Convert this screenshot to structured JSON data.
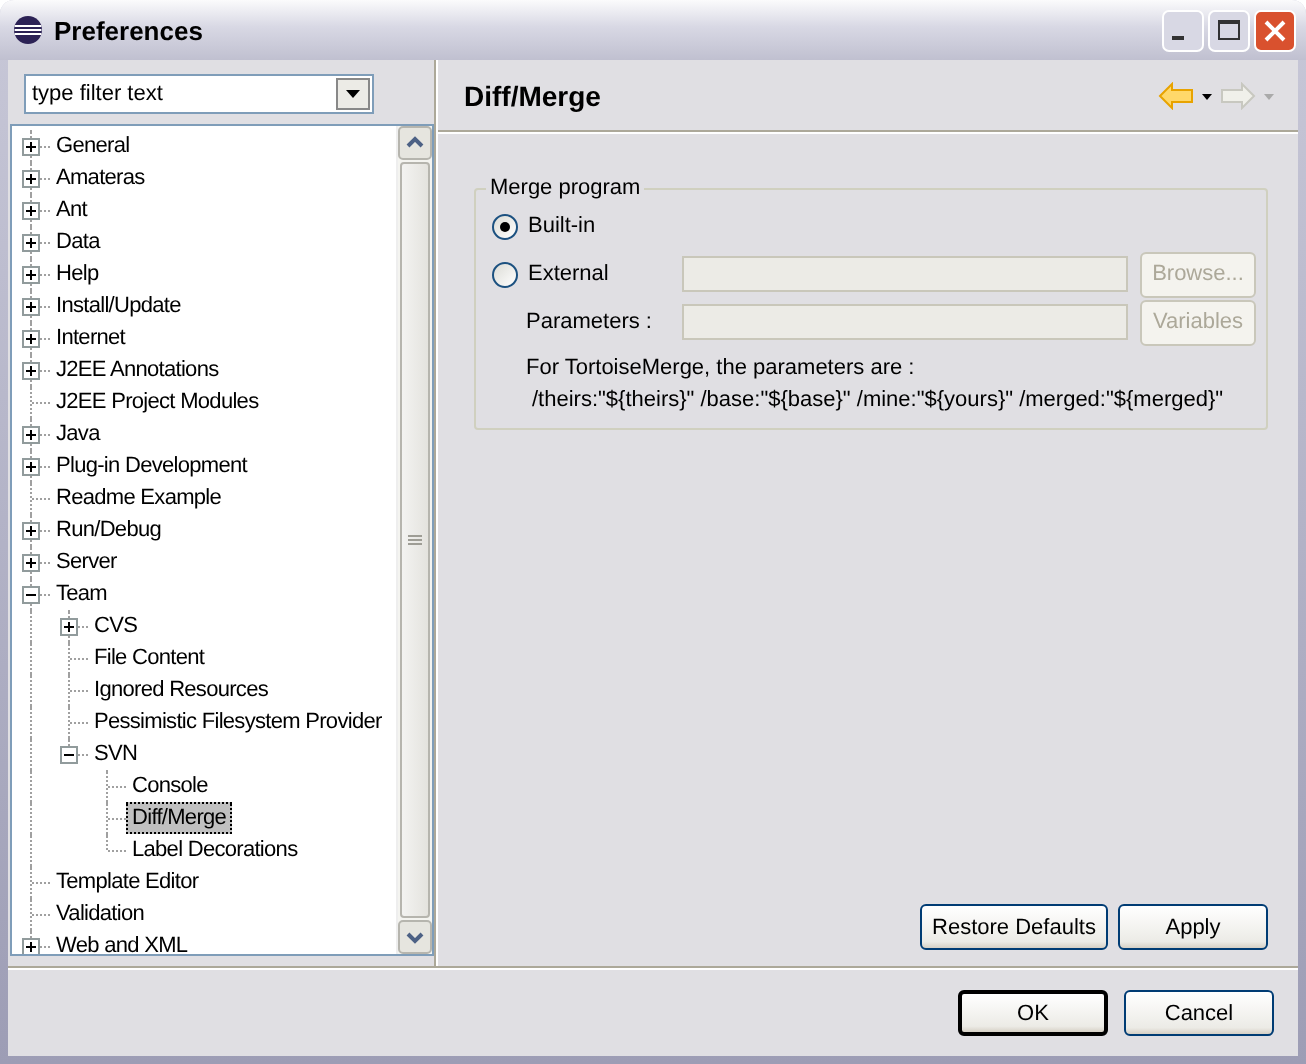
{
  "window": {
    "title": "Preferences"
  },
  "filter": {
    "placeholder": "type filter text"
  },
  "tree": [
    {
      "label": "General",
      "expanded": false,
      "selected": false
    },
    {
      "label": "Amateras",
      "expanded": false,
      "selected": false
    },
    {
      "label": "Ant",
      "expanded": false,
      "selected": false
    },
    {
      "label": "Data",
      "expanded": false,
      "selected": false
    },
    {
      "label": "Help",
      "expanded": false,
      "selected": false
    },
    {
      "label": "Install/Update",
      "expanded": false,
      "selected": false
    },
    {
      "label": "Internet",
      "expanded": false,
      "selected": false
    },
    {
      "label": "J2EE Annotations",
      "expanded": false,
      "selected": false
    },
    {
      "label": "J2EE Project Modules",
      "selected": false
    },
    {
      "label": "Java",
      "expanded": false,
      "selected": false
    },
    {
      "label": "Plug-in Development",
      "expanded": false,
      "selected": false
    },
    {
      "label": "Readme Example",
      "selected": false
    },
    {
      "label": "Run/Debug",
      "expanded": false,
      "selected": false
    },
    {
      "label": "Server",
      "expanded": false,
      "selected": false
    },
    {
      "label": "Team",
      "expanded": true,
      "selected": false,
      "children": [
        {
          "label": "CVS",
          "expanded": false,
          "selected": false
        },
        {
          "label": "File Content",
          "selected": false
        },
        {
          "label": "Ignored Resources",
          "selected": false
        },
        {
          "label": "Pessimistic Filesystem Provider",
          "selected": false
        },
        {
          "label": "SVN",
          "expanded": true,
          "selected": false,
          "children": [
            {
              "label": "Console",
              "selected": false
            },
            {
              "label": "Diff/Merge",
              "selected": true
            },
            {
              "label": "Label Decorations",
              "selected": false
            }
          ]
        }
      ]
    },
    {
      "label": "Template Editor",
      "selected": false
    },
    {
      "label": "Validation",
      "selected": false
    },
    {
      "label": "Web and XML",
      "expanded": false,
      "selected": false
    }
  ],
  "page": {
    "title": "Diff/Merge",
    "nav": [
      {
        "disabled": false
      },
      {
        "disabled": true
      }
    ],
    "group": {
      "title": "Merge program",
      "options": [
        {
          "label": "Built-in",
          "selected": true
        },
        {
          "label": "External",
          "selected": false
        }
      ],
      "external_field": {
        "disabled": true
      },
      "browse_button": {
        "label": "Browse...",
        "disabled": true
      },
      "parameters_label": "Parameters :",
      "parameters_field": {
        "disabled": true
      },
      "variables_button": {
        "label": "Variables",
        "disabled": true
      },
      "hint": "For TortoiseMerge, the parameters are :",
      "example": "/theirs:\"${theirs}\" /base:\"${base}\" /mine:\"${yours}\" /merged:\"${merged}\""
    },
    "buttons": [
      "Restore Defaults",
      "Apply"
    ]
  },
  "buttons": [
    {
      "label": "OK",
      "default": true
    },
    {
      "label": "Cancel",
      "default": false
    }
  ]
}
